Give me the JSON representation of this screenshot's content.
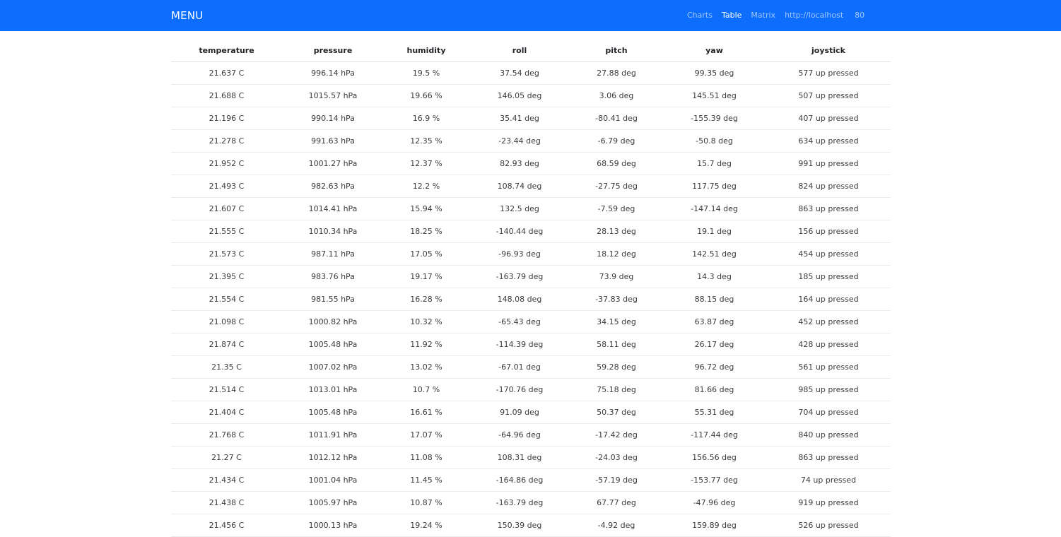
{
  "navbar": {
    "brand": "MENU",
    "links": [
      "Charts",
      "Table",
      "Matrix"
    ],
    "active": "Table",
    "host": "http://localhost",
    "port": "80",
    "background": "#0d6efd"
  },
  "table": {
    "headers": [
      "temperature",
      "pressure",
      "humidity",
      "roll",
      "pitch",
      "yaw",
      "joystick"
    ],
    "rows": [
      [
        "21.637 C",
        "996.14 hPa",
        "19.5 %",
        "37.54 deg",
        "27.88 deg",
        "99.35 deg",
        "577 up pressed"
      ],
      [
        "21.688 C",
        "1015.57 hPa",
        "19.66 %",
        "146.05 deg",
        "3.06 deg",
        "145.51 deg",
        "507 up pressed"
      ],
      [
        "21.196 C",
        "990.14 hPa",
        "16.9 %",
        "35.41 deg",
        "-80.41 deg",
        "-155.39 deg",
        "407 up pressed"
      ],
      [
        "21.278 C",
        "991.63 hPa",
        "12.35 %",
        "-23.44 deg",
        "-6.79 deg",
        "-50.8 deg",
        "634 up pressed"
      ],
      [
        "21.952 C",
        "1001.27 hPa",
        "12.37 %",
        "82.93 deg",
        "68.59 deg",
        "15.7 deg",
        "991 up pressed"
      ],
      [
        "21.493 C",
        "982.63 hPa",
        "12.2 %",
        "108.74 deg",
        "-27.75 deg",
        "117.75 deg",
        "824 up pressed"
      ],
      [
        "21.607 C",
        "1014.41 hPa",
        "15.94 %",
        "132.5 deg",
        "-7.59 deg",
        "-147.14 deg",
        "863 up pressed"
      ],
      [
        "21.555 C",
        "1010.34 hPa",
        "18.25 %",
        "-140.44 deg",
        "28.13 deg",
        "19.1 deg",
        "156 up pressed"
      ],
      [
        "21.573 C",
        "987.11 hPa",
        "17.05 %",
        "-96.93 deg",
        "18.12 deg",
        "142.51 deg",
        "454 up pressed"
      ],
      [
        "21.395 C",
        "983.76 hPa",
        "19.17 %",
        "-163.79 deg",
        "73.9 deg",
        "14.3 deg",
        "185 up pressed"
      ],
      [
        "21.554 C",
        "981.55 hPa",
        "16.28 %",
        "148.08 deg",
        "-37.83 deg",
        "88.15 deg",
        "164 up pressed"
      ],
      [
        "21.098 C",
        "1000.82 hPa",
        "10.32 %",
        "-65.43 deg",
        "34.15 deg",
        "63.87 deg",
        "452 up pressed"
      ],
      [
        "21.874 C",
        "1005.48 hPa",
        "11.92 %",
        "-114.39 deg",
        "58.11 deg",
        "26.17 deg",
        "428 up pressed"
      ],
      [
        "21.35 C",
        "1007.02 hPa",
        "13.02 %",
        "-67.01 deg",
        "59.28 deg",
        "96.72 deg",
        "561 up pressed"
      ],
      [
        "21.514 C",
        "1013.01 hPa",
        "10.7 %",
        "-170.76 deg",
        "75.18 deg",
        "81.66 deg",
        "985 up pressed"
      ],
      [
        "21.404 C",
        "1005.48 hPa",
        "16.61 %",
        "91.09 deg",
        "50.37 deg",
        "55.31 deg",
        "704 up pressed"
      ],
      [
        "21.768 C",
        "1011.91 hPa",
        "17.07 %",
        "-64.96 deg",
        "-17.42 deg",
        "-117.44 deg",
        "840 up pressed"
      ],
      [
        "21.27 C",
        "1012.12 hPa",
        "11.08 %",
        "108.31 deg",
        "-24.03 deg",
        "156.56 deg",
        "863 up pressed"
      ],
      [
        "21.434 C",
        "1001.04 hPa",
        "11.45 %",
        "-164.86 deg",
        "-57.19 deg",
        "-153.77 deg",
        "74 up pressed"
      ],
      [
        "21.438 C",
        "1005.97 hPa",
        "10.87 %",
        "-163.79 deg",
        "67.77 deg",
        "-47.96 deg",
        "919 up pressed"
      ],
      [
        "21.456 C",
        "1000.13 hPa",
        "19.24 %",
        "150.39 deg",
        "-4.92 deg",
        "159.89 deg",
        "526 up pressed"
      ]
    ]
  }
}
